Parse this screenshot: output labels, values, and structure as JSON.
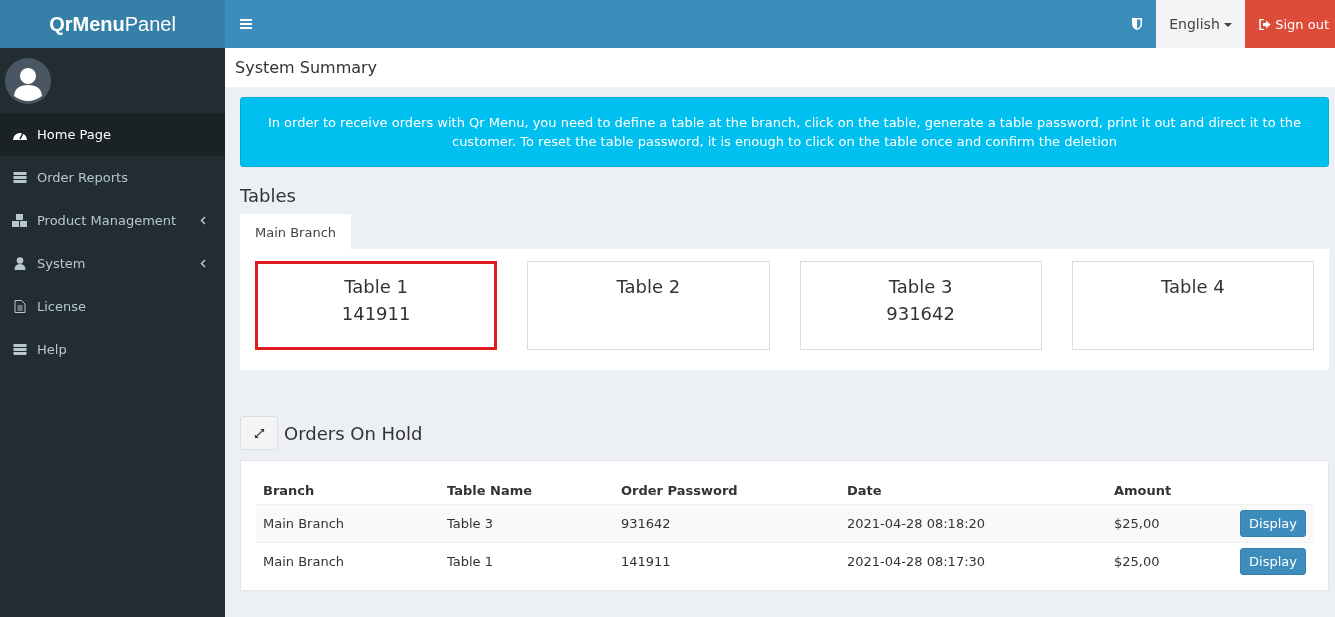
{
  "brand": "**QrMenu**Panel",
  "topbar": {
    "language": "English",
    "sign_out": "Sign out"
  },
  "sidebar": {
    "items": [
      {
        "label": "Home Page",
        "kind": "dashboard",
        "selected": true,
        "submenu": false
      },
      {
        "label": "Order Reports",
        "kind": "list",
        "selected": false,
        "submenu": false
      },
      {
        "label": "Product Management",
        "kind": "cubes",
        "selected": false,
        "submenu": true
      },
      {
        "label": "System",
        "kind": "user",
        "selected": false,
        "submenu": true
      },
      {
        "label": "License",
        "kind": "file",
        "selected": false,
        "submenu": false
      },
      {
        "label": "Help",
        "kind": "list",
        "selected": false,
        "submenu": false
      }
    ]
  },
  "page_title": "System Summary",
  "alert": "In order to receive orders with Qr Menu, you need to define a table at the branch, click on the table, generate a table password, print it out and direct it to the customer. To reset the table password, it is enough to click on the table once and confirm the deletion",
  "tables_heading": "Tables",
  "branch_tabs": [
    {
      "label": "Main Branch",
      "selected": true
    }
  ],
  "tables": [
    {
      "name": "Table 1",
      "password": "141911",
      "selected": true
    },
    {
      "name": "Table 2",
      "selected": false
    },
    {
      "name": "Table 3",
      "password": "931642",
      "selected": false
    },
    {
      "name": "Table 4",
      "selected": false
    }
  ],
  "orders": {
    "title": "Orders On Hold",
    "columns": [
      "Branch",
      "Table Name",
      "Order Password",
      "Date",
      "Amount"
    ],
    "rows": [
      {
        "cells": [
          "Main Branch",
          "Table 3",
          "931642",
          "2021-04-28 08:18:20",
          "$25,00"
        ],
        "action": "Display"
      },
      {
        "cells": [
          "Main Branch",
          "Table 1",
          "141911",
          "2021-04-28 08:17:30",
          "$25,00"
        ],
        "action": "Display"
      }
    ]
  }
}
